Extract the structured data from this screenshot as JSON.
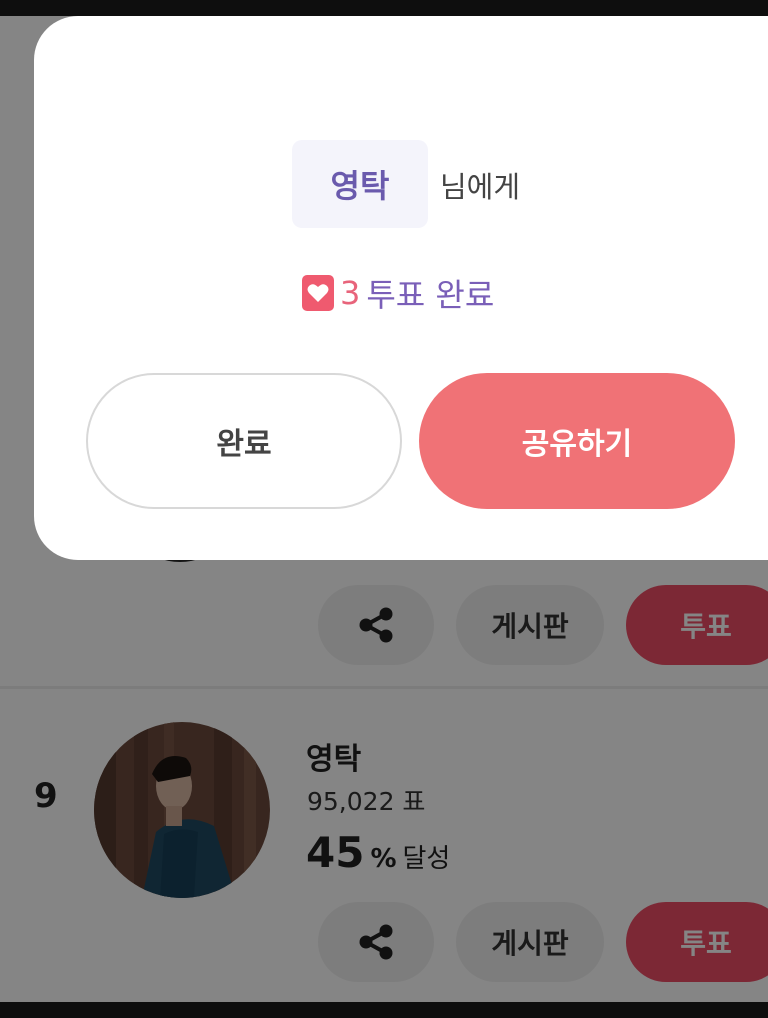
{
  "modal": {
    "recipient_name": "영탁",
    "recipient_suffix": "님에게",
    "vote_count": "3",
    "vote_result_text": "투표 완료",
    "done_button": "완료",
    "share_button": "공유하기"
  },
  "actions": {
    "board_label": "게시판",
    "vote_label": "투표"
  },
  "ranking_item": {
    "rank": "9",
    "name": "영탁",
    "votes_text": "95,022 표",
    "percent": "45",
    "percent_unit": "%",
    "percent_label": "달성"
  },
  "icons": {
    "share": "share-icon",
    "heart": "heart-icon"
  },
  "colors": {
    "accent_red": "#ee4e66",
    "share_button": "#f07276",
    "name_purple": "#6a5aad",
    "overlay": "rgba(0,0,0,0.48)"
  }
}
